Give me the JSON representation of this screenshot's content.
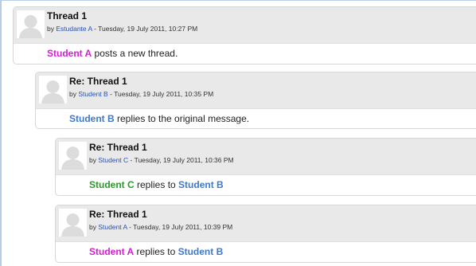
{
  "colors": {
    "student_a": "#d41ed4",
    "student_b": "#3f78cc",
    "student_c": "#2a9a2a",
    "author_link": "#2651b9",
    "header_bg": "#e9e9e9"
  },
  "posts": [
    {
      "subject": "Thread 1",
      "by_prefix": "by",
      "author": "Estudante A",
      "date": " - Tuesday, 19 July 2011, 10:27 PM",
      "body_name": "Student A",
      "body_text": " posts a new thread.",
      "body_target": "",
      "avatar_icon": "user-silhouette-icon"
    },
    {
      "subject": "Re: Thread 1",
      "by_prefix": "by",
      "author": "Student B",
      "date": " - Tuesday, 19 July 2011, 10:35 PM",
      "body_name": "Student B",
      "body_text": " replies to the original message.",
      "body_target": "",
      "avatar_icon": "user-silhouette-icon"
    },
    {
      "subject": "Re: Thread 1",
      "by_prefix": "by",
      "author": "Student C",
      "date": " - Tuesday, 19 July 2011, 10:36 PM",
      "body_name": "Student C",
      "body_text": " replies to ",
      "body_target": "Student B",
      "avatar_icon": "user-silhouette-icon"
    },
    {
      "subject": "Re: Thread 1",
      "by_prefix": "by",
      "author": "Student A",
      "date": " - Tuesday, 19 July 2011, 10:39 PM",
      "body_name": "Student A",
      "body_text": " replies to ",
      "body_target": "Student B",
      "avatar_icon": "user-silhouette-icon"
    }
  ]
}
